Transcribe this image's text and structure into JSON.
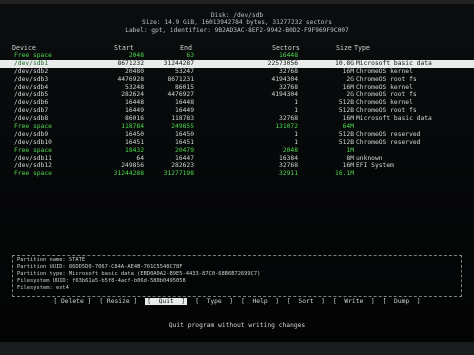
{
  "header": {
    "disk": "Disk: /dev/sdb",
    "size": "Size: 14.9 GiB, 16013942784 bytes, 31277232 sectors",
    "label": "Label: gpt, identifier: 9B2AD3AC-8EF2-9942-B0D2-F9F969F9C007"
  },
  "columns": {
    "device": "Device",
    "start": "Start",
    "end": "End",
    "sectors": "Sectors",
    "size": "Size",
    "type": "Type"
  },
  "rows": [
    {
      "device": "Free space",
      "start": "2048",
      "end": "63",
      "sectors": "16448",
      "size": "",
      "type": "",
      "kind": "free"
    },
    {
      "device": "/dev/sdb1",
      "start": "8671232",
      "end": "31244287",
      "sectors": "22573056",
      "size": "10.8G",
      "type": "Microsoft basic data",
      "kind": "sel"
    },
    {
      "device": "/dev/sdb2",
      "start": "20480",
      "end": "53247",
      "sectors": "32768",
      "size": "16M",
      "type": "ChromeOS kernel",
      "kind": ""
    },
    {
      "device": "/dev/sdb3",
      "start": "4476928",
      "end": "8671231",
      "sectors": "4194304",
      "size": "2G",
      "type": "ChromeOS root fs",
      "kind": ""
    },
    {
      "device": "/dev/sdb4",
      "start": "53248",
      "end": "86015",
      "sectors": "32768",
      "size": "16M",
      "type": "ChromeOS kernel",
      "kind": ""
    },
    {
      "device": "/dev/sdb5",
      "start": "282624",
      "end": "4476927",
      "sectors": "4194304",
      "size": "2G",
      "type": "ChromeOS root fs",
      "kind": ""
    },
    {
      "device": "/dev/sdb6",
      "start": "16448",
      "end": "16448",
      "sectors": "1",
      "size": "512B",
      "type": "ChromeOS kernel",
      "kind": ""
    },
    {
      "device": "/dev/sdb7",
      "start": "16449",
      "end": "16449",
      "sectors": "1",
      "size": "512B",
      "type": "ChromeOS root fs",
      "kind": ""
    },
    {
      "device": "/dev/sdb8",
      "start": "86016",
      "end": "118783",
      "sectors": "32768",
      "size": "16M",
      "type": "Microsoft basic data",
      "kind": ""
    },
    {
      "device": "Free space",
      "start": "118784",
      "end": "249855",
      "sectors": "131072",
      "size": "64M",
      "type": "",
      "kind": "free"
    },
    {
      "device": "/dev/sdb9",
      "start": "16450",
      "end": "16450",
      "sectors": "1",
      "size": "512B",
      "type": "ChromeOS reserved",
      "kind": ""
    },
    {
      "device": "/dev/sdb10",
      "start": "16451",
      "end": "16451",
      "sectors": "1",
      "size": "512B",
      "type": "ChromeOS reserved",
      "kind": ""
    },
    {
      "device": "Free space",
      "start": "18432",
      "end": "20479",
      "sectors": "2048",
      "size": "1M",
      "type": "",
      "kind": "free"
    },
    {
      "device": "/dev/sdb11",
      "start": "64",
      "end": "16447",
      "sectors": "16384",
      "size": "8M",
      "type": "unknown",
      "kind": ""
    },
    {
      "device": "/dev/sdb12",
      "start": "249856",
      "end": "282623",
      "sectors": "32768",
      "size": "16M",
      "type": "EFI System",
      "kind": ""
    },
    {
      "device": "Free space",
      "start": "31244288",
      "end": "31277198",
      "sectors": "32911",
      "size": "16.1M",
      "type": "",
      "kind": "free"
    }
  ],
  "info": [
    "Partition name: STATE",
    "Partition UUID: 86DD5D0-7067-C84A-AE4B-761C5548C78F",
    "Partition type: Microsoft basic data (EBD0A0A2-B9E5-4433-87C0-68B6B72699C7)",
    "Filesystem UUID: f63b61a5-b5f8-4acf-b06d-580b0495058",
    "Filesystem: ext4"
  ],
  "menu": {
    "row1": [
      "[ Delete ]",
      "[ Resize ]",
      "[  Quit  ]",
      "[  Type  ]",
      "[  Help  ]",
      "[  Sort  ]",
      "[  Write  ]",
      "[  Dump  ]"
    ],
    "selected": "[  Quit  ]"
  },
  "status": "Quit program without writing changes"
}
